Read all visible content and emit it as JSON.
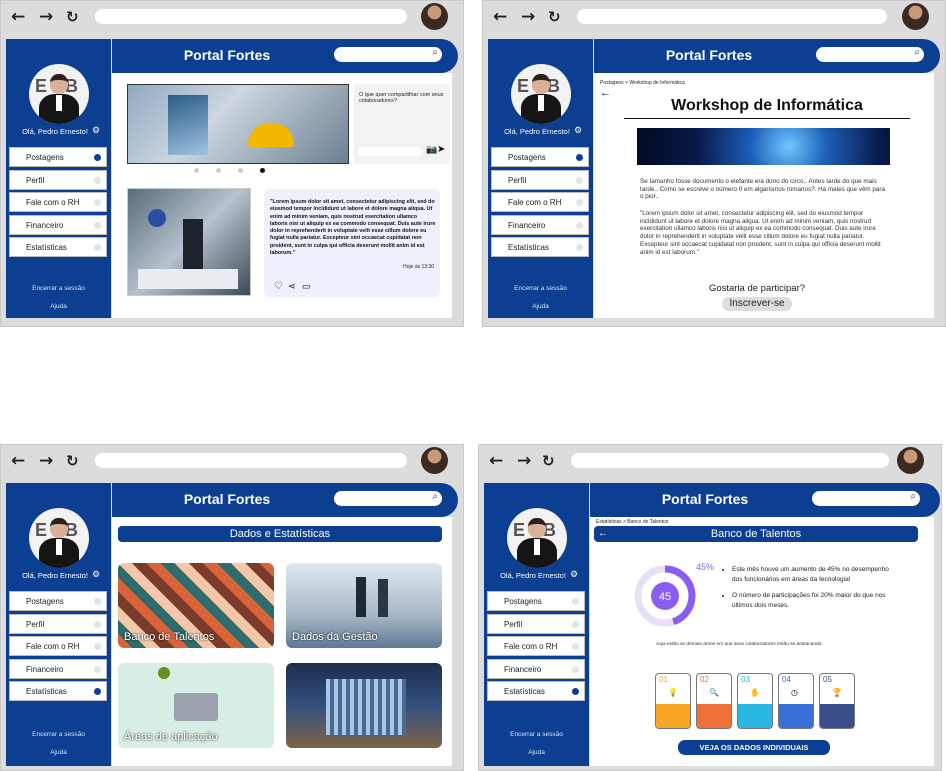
{
  "app": {
    "title": "Portal Fortes"
  },
  "sidebar": {
    "greeting": "Olá, Pedro Ernesto!",
    "logout": "Encerrar a sessão",
    "help": "Ajuda",
    "items": [
      {
        "label": "Postagens"
      },
      {
        "label": "Perfil"
      },
      {
        "label": "Fale com o RH"
      },
      {
        "label": "Financeiro"
      },
      {
        "label": "Estatísticas"
      }
    ]
  },
  "screen1": {
    "compose_placeholder": "O que quer compartilhar com seus colaboradores?",
    "post_text": "\"Lorem ipsum dolor sit amet, consectetur adipiscing elit, sed do eiusmod tempor incididunt ut labore et dolore magna aliqua. Ut enim ad minim veniam, quis nostrud exercitation ullamco laboris nisi ut aliquip ex ea commodo consequat. Duis aute irure dolor in reprehenderit in voluptate velit esse cillum dolore eu fugiat nulla pariatur. Excepteur sint occaecat cupidatat non proident, sunt in culpa qui officia deserunt mollit anim id est laborum.\"",
    "post_time": "Hoje às 13:30"
  },
  "screen2": {
    "breadcrumb": "Postagens > Workshop de Informática",
    "title": "Workshop de Informática",
    "para1": "Se tamanho fosse documento o elefante era dono do circo.. Antes tarde do que mais tarde.. Como se escreve o número 0 em algarismos romanos?. Há males que vêm para o pior..",
    "para2": "\"Lorem ipsum dolor sit amet, consectetur adipiscing elit, sed do eiusmod tempor incididunt ut labore et dolore magna aliqua. Ut enim ad minim veniam, quis nostrud exercitation ullamco laboris nisi ut aliquip ex ea commodo consequat. Duis aute irure dolor in reprehenderit in voluptate velit esse cillum dolore eu fugiat nulla pariatur. Excepteur sint occaecat cupidatat non proident, sunt in culpa qui officia deserunt mollit anim id est laborum.\"",
    "question": "Gostaria de participar?",
    "subscribe": "Inscrever-se"
  },
  "screen3": {
    "heading": "Dados e Estatísticas",
    "cards": [
      {
        "label": "Banco de Talentos"
      },
      {
        "label": "Dados da Gestão"
      },
      {
        "label": "Áreas de aplicação"
      },
      {
        "label": ""
      }
    ]
  },
  "screen4": {
    "breadcrumb": "Estatísticas > Banco de Talentos",
    "heading": "Banco de Talentos",
    "percent": "45%",
    "donut_value": "45",
    "donut_fraction": 0.45,
    "bullet1": "Este mês houve um aumento de 45% no desempenho dos funcionários em áreas da tecnologia!",
    "bullet2": "O número de participações foi 20% maior do que nos últimos dois meses.",
    "areas_caption": "Aqui estão as demais áreas em que seus colaboradores estão se destacando:",
    "steps": [
      {
        "num": "01"
      },
      {
        "num": "02"
      },
      {
        "num": "03"
      },
      {
        "num": "04"
      },
      {
        "num": "05"
      }
    ],
    "step_colors": [
      "#f6a623",
      "#f0703a",
      "#2ab7e4",
      "#3a6fd8",
      "#3a4e8c"
    ],
    "cta": "VEJA OS DADOS INDIVIDUAIS"
  }
}
